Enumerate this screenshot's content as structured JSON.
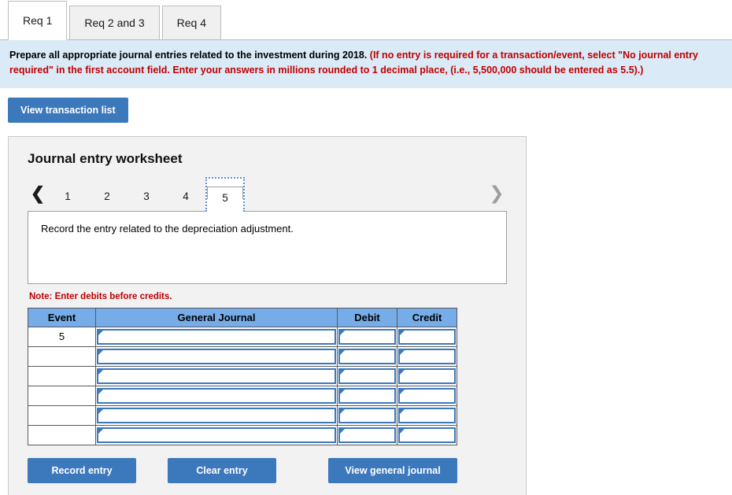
{
  "tabs": [
    {
      "label": "Req 1",
      "active": true
    },
    {
      "label": "Req 2 and 3",
      "active": false
    },
    {
      "label": "Req 4",
      "active": false
    }
  ],
  "instructions": {
    "main": "Prepare all appropriate journal entries related to the investment during 2018.",
    "hint": "(If no entry is required for a transaction/event, select \"No journal entry required\" in the first account field. Enter your answers in millions rounded to 1 decimal place, (i.e., 5,500,000 should be entered as 5.5).)"
  },
  "toolbar": {
    "view_transaction_list": "View transaction list"
  },
  "worksheet": {
    "title": "Journal entry worksheet",
    "pager": {
      "prev_icon": "chevron-left",
      "next_icon": "chevron-right",
      "pages": [
        "1",
        "2",
        "3",
        "4",
        "5"
      ],
      "selected": "5"
    },
    "description": "Record the entry related to the depreciation adjustment.",
    "note": "Note: Enter debits before credits.",
    "table": {
      "headers": [
        "Event",
        "General Journal",
        "Debit",
        "Credit"
      ],
      "rows": [
        {
          "event": "5",
          "general_journal": "",
          "debit": "",
          "credit": ""
        },
        {
          "event": "",
          "general_journal": "",
          "debit": "",
          "credit": ""
        },
        {
          "event": "",
          "general_journal": "",
          "debit": "",
          "credit": ""
        },
        {
          "event": "",
          "general_journal": "",
          "debit": "",
          "credit": ""
        },
        {
          "event": "",
          "general_journal": "",
          "debit": "",
          "credit": ""
        },
        {
          "event": "",
          "general_journal": "",
          "debit": "",
          "credit": ""
        }
      ]
    },
    "buttons": {
      "record_entry": "Record entry",
      "clear_entry": "Clear entry",
      "view_general_journal": "View general journal"
    }
  },
  "colors": {
    "primary_blue": "#3c78bc",
    "header_blue": "#76ace8",
    "banner_blue": "#daeaf7",
    "panel_gray": "#f2f2f2",
    "warning_red": "#c00000"
  }
}
